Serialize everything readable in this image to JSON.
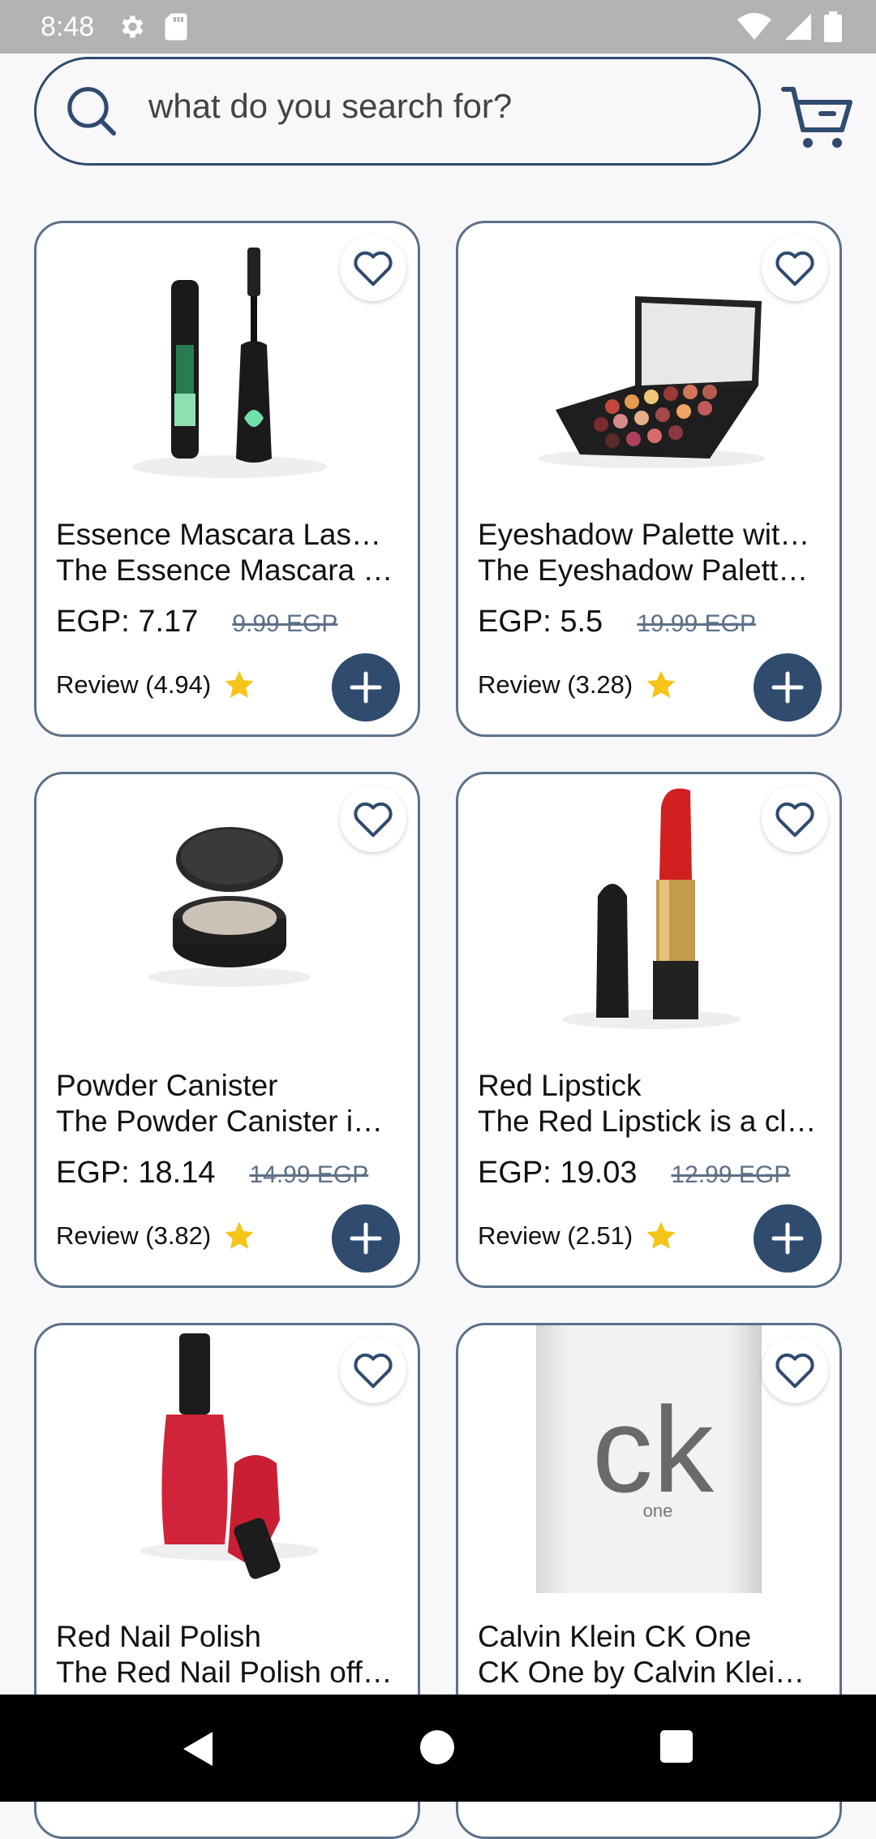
{
  "status_bar": {
    "time": "8:48",
    "icons_left": [
      "gear-icon",
      "sd-card-icon"
    ],
    "icons_right": [
      "wifi-icon",
      "signal-icon",
      "battery-icon"
    ]
  },
  "search": {
    "placeholder": "what do you search for?",
    "icon": "search-icon"
  },
  "cart": {
    "icon": "cart-icon"
  },
  "colors": {
    "accent": "#2f4b6e",
    "border": "#5c7088",
    "star": "#f5c518",
    "background": "#f8f8fa"
  },
  "products": [
    {
      "title": "Essence Mascara Lash Princess",
      "description": "The Essence Mascara Lash Princess is a popular mascara",
      "price": "EGP: 7.17",
      "old_price": "9.99 EGP",
      "review": "Review (4.94)"
    },
    {
      "title": "Eyeshadow Palette with Mirror",
      "description": "The Eyeshadow Palette with Mirror offers a versatile range",
      "price": "EGP: 5.5",
      "old_price": "19.99 EGP",
      "review": "Review (3.28)"
    },
    {
      "title": "Powder Canister",
      "description": "The Powder Canister is a finely milled setting powder",
      "price": "EGP: 18.14",
      "old_price": "14.99 EGP",
      "review": "Review (3.82)"
    },
    {
      "title": "Red Lipstick",
      "description": "The Red Lipstick is a classic and bold choice",
      "price": "EGP: 19.03",
      "old_price": "12.99 EGP",
      "review": "Review (2.51)"
    },
    {
      "title": "Red Nail Polish",
      "description": "The Red Nail Polish offers a rich and glossy red hue",
      "price": "",
      "old_price": "",
      "review": ""
    },
    {
      "title": "Calvin Klein CK One",
      "description": "CK One by Calvin Klein is a classic unisex fragrance",
      "price": "",
      "old_price": "",
      "review": "",
      "image_text_main": "ck",
      "image_text_sub": "one"
    }
  ],
  "nav_bar": {
    "icons": [
      "back-icon",
      "home-icon",
      "recents-icon"
    ]
  }
}
